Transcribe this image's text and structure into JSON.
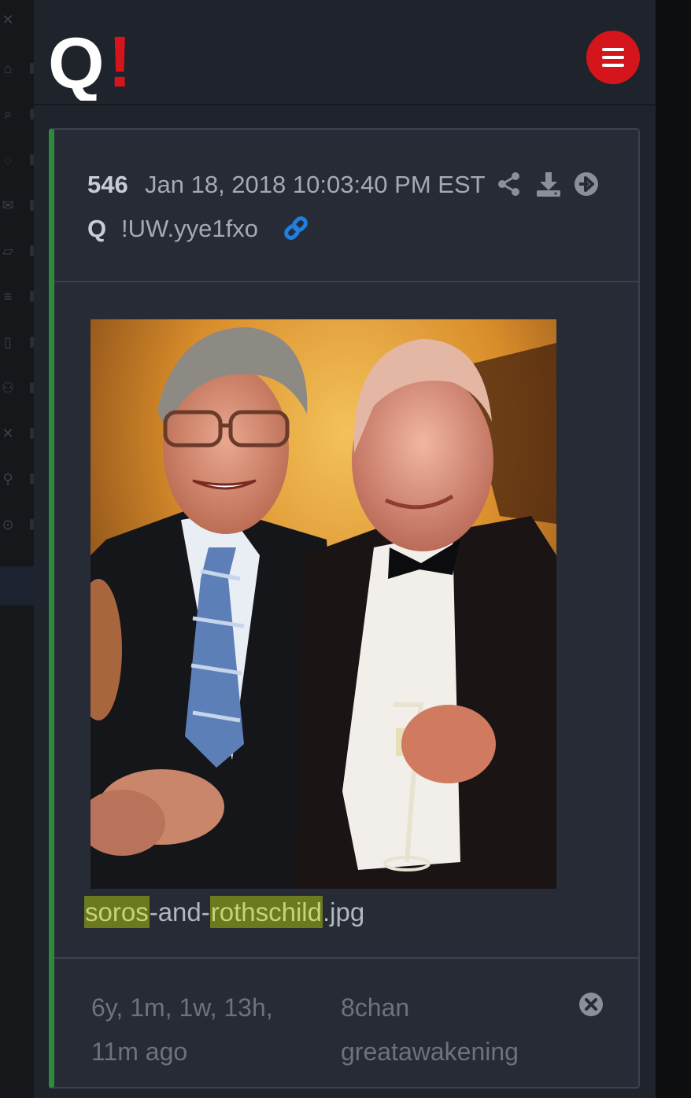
{
  "header": {
    "logo_letter": "Q",
    "logo_mark": "!",
    "menu_icon": "hamburger-menu-icon",
    "accent": "#d4151b"
  },
  "post": {
    "number": "546",
    "date": "Jan 18, 2018 10:03:40 PM EST",
    "author": "Q",
    "tripcode": "!UW.yye1fxo",
    "accent": "#2e8b3e",
    "icons": [
      "share-icon",
      "download-icon",
      "next-arrow-icon",
      "link-icon"
    ],
    "image": {
      "description_icon": "photo-image"
    },
    "filename_parts": {
      "p1": "soros",
      "p2": "-and-",
      "p3": "rothschild",
      "p4": ".jpg"
    },
    "highlight_color": "#6b7a1e",
    "ago": "6y, 1m, 1w, 13h, 11m ago",
    "source": "8chan greatawakening",
    "close_icon": "close-circle-icon"
  }
}
